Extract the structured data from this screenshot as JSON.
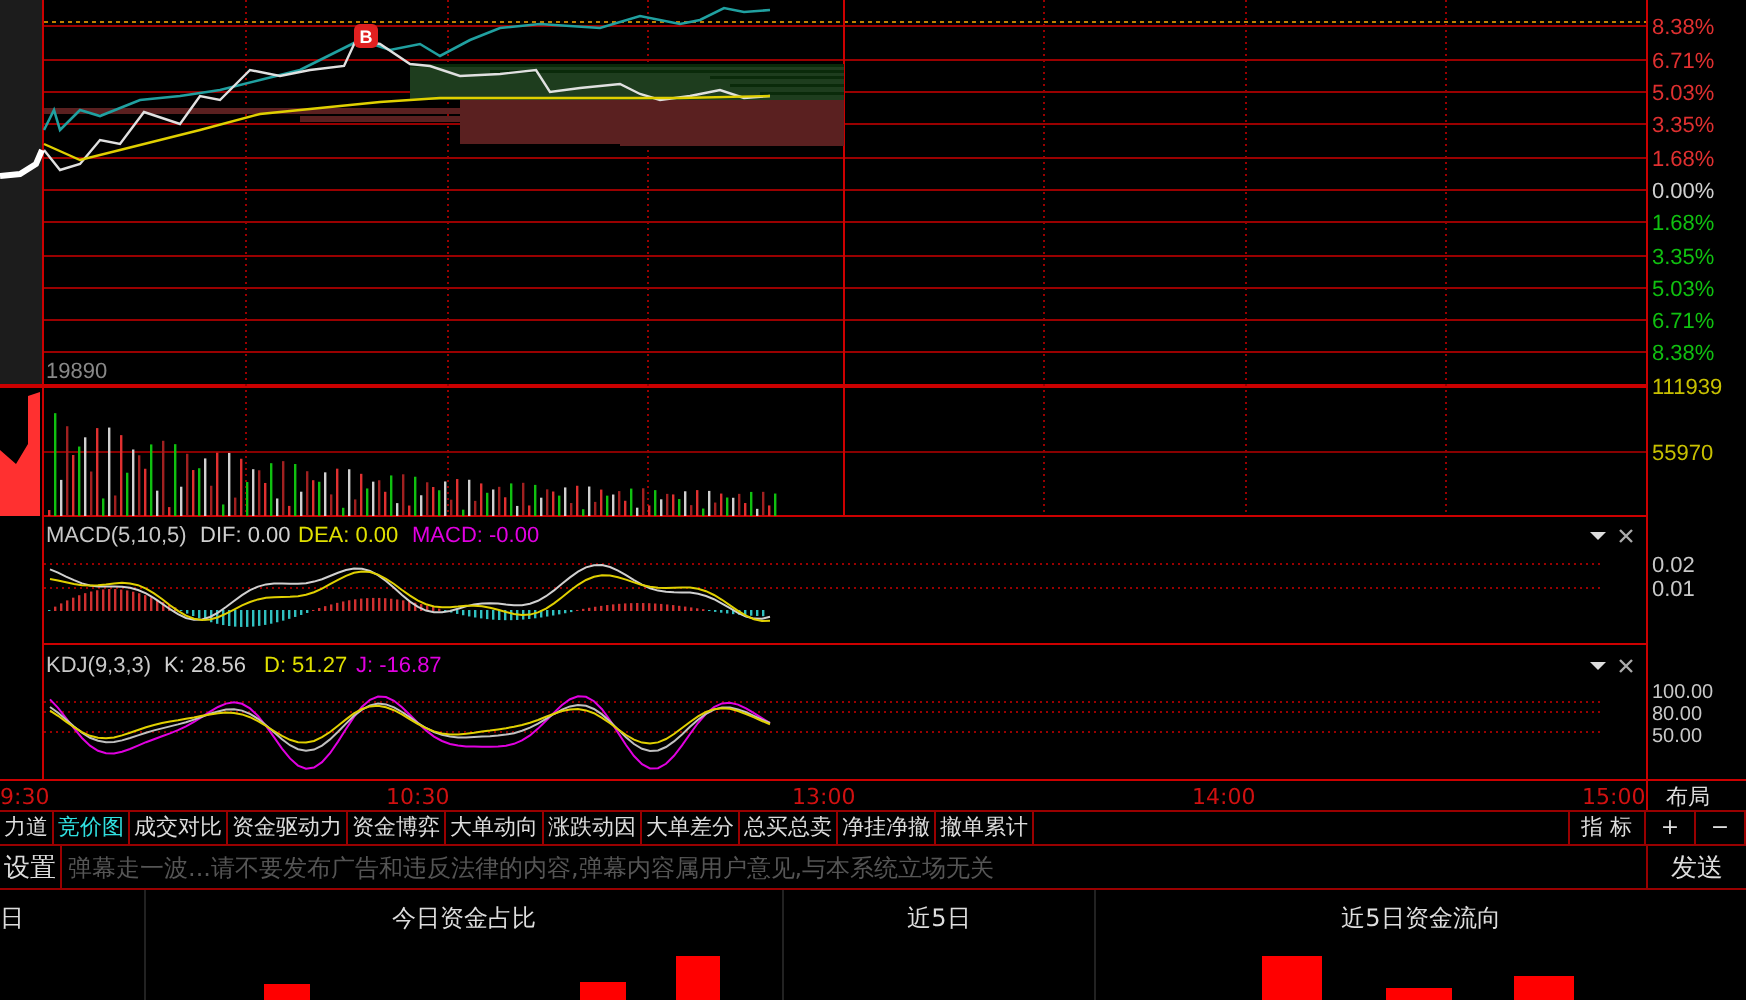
{
  "price_chart": {
    "marker": "B",
    "volume_label": "19890",
    "right_ticks": [
      {
        "label": "8.38%",
        "color": "#e03030"
      },
      {
        "label": "6.71%",
        "color": "#e03030"
      },
      {
        "label": "5.03%",
        "color": "#e03030"
      },
      {
        "label": "3.35%",
        "color": "#e03030"
      },
      {
        "label": "1.68%",
        "color": "#e03030"
      },
      {
        "label": "0.00%",
        "color": "#d0d0d0"
      },
      {
        "label": "1.68%",
        "color": "#10c010"
      },
      {
        "label": "3.35%",
        "color": "#10c010"
      },
      {
        "label": "5.03%",
        "color": "#10c010"
      },
      {
        "label": "6.71%",
        "color": "#10c010"
      },
      {
        "label": "8.38%",
        "color": "#10c010"
      }
    ],
    "volume_ticks": [
      "111939",
      "55970"
    ]
  },
  "macd": {
    "title": "MACD(5,10,5)",
    "values": [
      {
        "label": "DIF: 0.00",
        "color": "#d0d0d0"
      },
      {
        "label": "DEA: 0.00",
        "color": "#e0e000"
      },
      {
        "label": "MACD: -0.00",
        "color": "#e000e0"
      }
    ],
    "ticks": [
      "0.02",
      "0.01"
    ]
  },
  "kdj": {
    "title": "KDJ(9,3,3)",
    "values": [
      {
        "label": "K: 28.56",
        "color": "#d0d0d0"
      },
      {
        "label": "D: 51.27",
        "color": "#e0e000"
      },
      {
        "label": "J: -16.87",
        "color": "#e000e0"
      }
    ],
    "ticks": [
      "100.00",
      "80.00",
      "50.00"
    ]
  },
  "time_axis": [
    "9:30",
    "10:30",
    "13:00",
    "14:00",
    "15:00"
  ],
  "layout_button": "布局",
  "tabs": [
    {
      "label": "力道",
      "selected": false
    },
    {
      "label": "竞价图",
      "selected": true
    },
    {
      "label": "成交对比",
      "selected": false
    },
    {
      "label": "资金驱动力",
      "selected": false
    },
    {
      "label": "资金博弈",
      "selected": false
    },
    {
      "label": "大单动向",
      "selected": false
    },
    {
      "label": "涨跌动因",
      "selected": false
    },
    {
      "label": "大单差分",
      "selected": false
    },
    {
      "label": "总买总卖",
      "selected": false
    },
    {
      "label": "净挂净撤",
      "selected": false
    },
    {
      "label": "撤单累计",
      "selected": false
    }
  ],
  "indicator_button": "指 标",
  "zoom_buttons": [
    "+",
    "−"
  ],
  "danmu": {
    "settings": "设置",
    "placeholder": "弹幕走一波...请不要发布广告和违反法律的内容,弹幕内容属用户意见,与本系统立场无关",
    "send": "发送"
  },
  "bottom_headers": [
    "日",
    "今日资金占比",
    "近5日",
    "近5日资金流向"
  ]
}
